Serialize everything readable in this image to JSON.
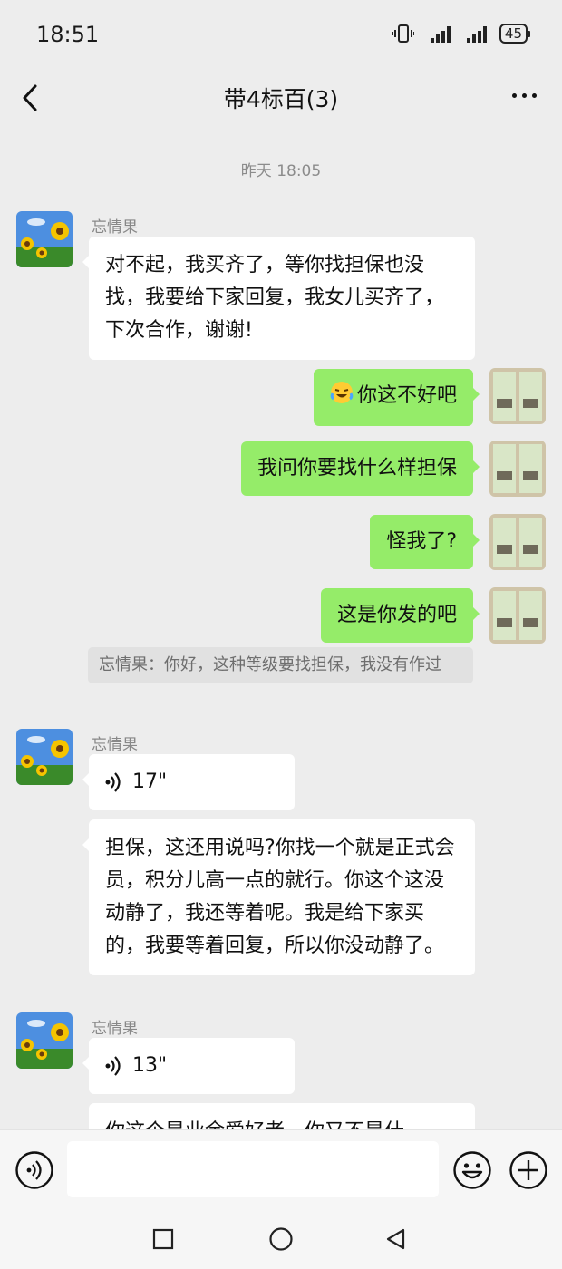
{
  "status_bar": {
    "time": "18:51",
    "battery": "45"
  },
  "header": {
    "title": "带4标百(3)"
  },
  "chat": {
    "timestamp": "昨天 18:05",
    "sender_name": "忘情果",
    "messages": [
      {
        "text": "对不起，我买齐了，等你找担保也没找，我要给下家回复，我女儿买齐了，下次合作，谢谢!"
      },
      {
        "text": "你这不好吧",
        "emoji": "face-with-tears-of-joy-icon"
      },
      {
        "text": "我问你要找什么样担保"
      },
      {
        "text": "怪我了?"
      },
      {
        "text": "这是你发的吧"
      },
      {
        "quote": "忘情果：你好，这种等级要找担保，我没有作过"
      },
      {
        "voice_duration": "17\""
      },
      {
        "text": "担保，这还用说吗?你找一个就是正式会员，积分儿高一点的就行。你这个这没动静了，我还等着呢。我是给下家买的，我要等着回复，所以你没动静了。"
      },
      {
        "voice_duration": "13\""
      },
      {
        "text": "你这个是业余爱好者，你又不是什"
      }
    ]
  },
  "colors": {
    "background": "#ededed",
    "outgoing_bubble": "#95ec69",
    "incoming_bubble": "#ffffff"
  }
}
